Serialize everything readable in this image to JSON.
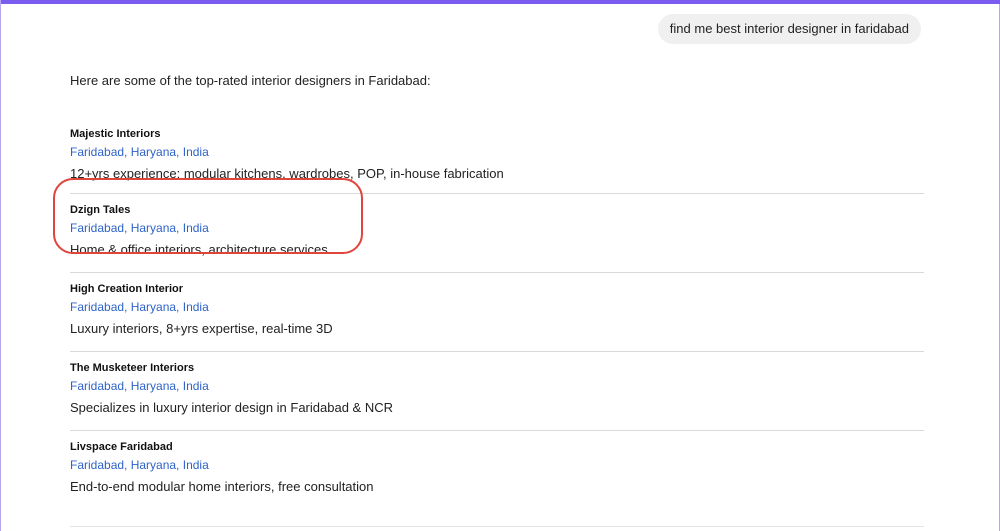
{
  "user_query": "find me best interior designer in faridabad",
  "answer": {
    "intro": "Here are some of the top-rated interior designers in Faridabad:",
    "items": [
      {
        "name": "Majestic Interiors",
        "location": "Faridabad, Haryana, India",
        "description": "12+yrs experience; modular kitchens, wardrobes, POP, in-house fabrication"
      },
      {
        "name": "Dzign Tales",
        "location": "Faridabad, Haryana, India",
        "description": "Home & office interiors, architecture services"
      },
      {
        "name": "High Creation Interior",
        "location": "Faridabad, Haryana, India",
        "description": "Luxury interiors, 8+yrs expertise, real-time 3D"
      },
      {
        "name": "The Musketeer Interiors",
        "location": "Faridabad, Haryana, India",
        "description": "Specializes in luxury interior design in Faridabad & NCR"
      },
      {
        "name": "Livspace Faridabad",
        "location": "Faridabad, Haryana, India",
        "description": "End-to-end modular home interiors, free consultation"
      }
    ]
  },
  "colors": {
    "accent_bar": "#7b5cf0",
    "location_link": "#2f63c8",
    "highlight_ring": "#e0453c"
  }
}
